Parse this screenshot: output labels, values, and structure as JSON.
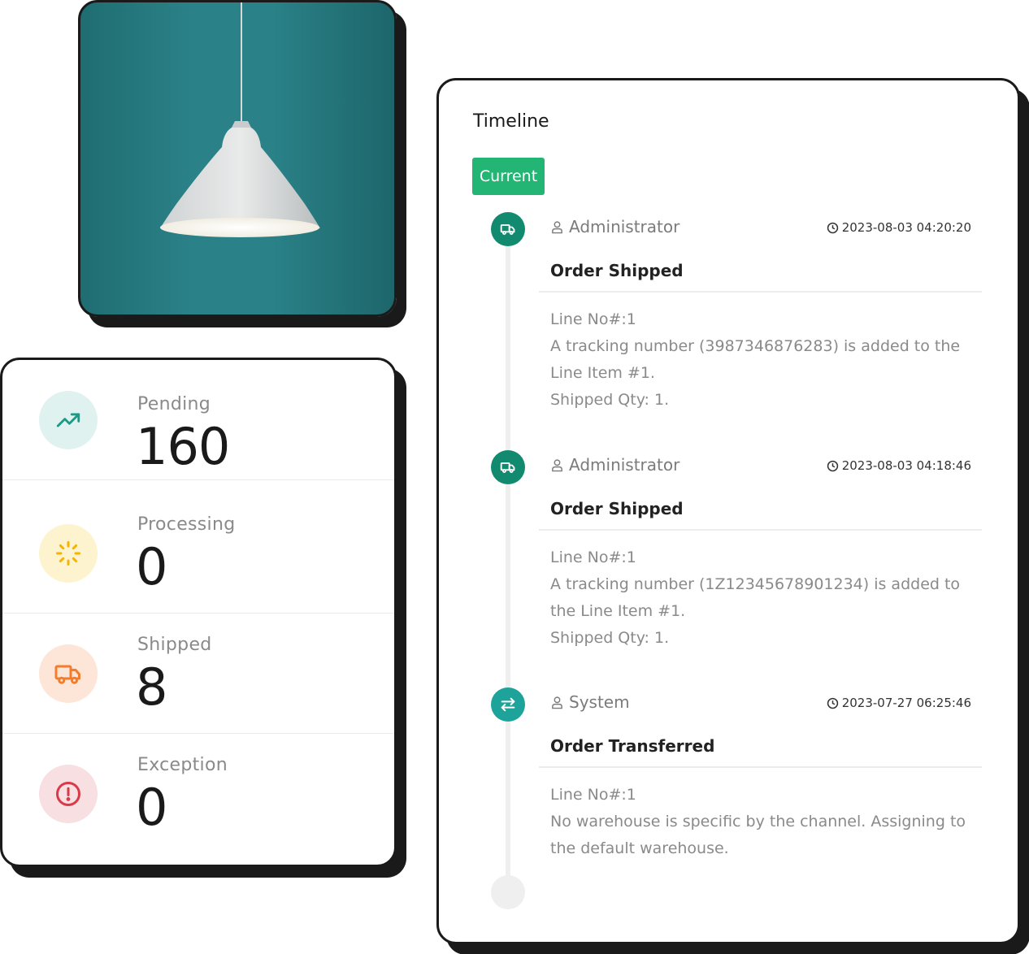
{
  "stats": [
    {
      "label": "Pending",
      "value": "160",
      "icon": "trending-up-icon",
      "icon_color": "#1a9b87",
      "bg": "#e0f2ef"
    },
    {
      "label": "Processing",
      "value": "0",
      "icon": "loader-icon",
      "icon_color": "#f4b400",
      "bg": "#fdf3cf"
    },
    {
      "label": "Shipped",
      "value": "8",
      "icon": "truck-icon",
      "icon_color": "#f57c2a",
      "bg": "#fde6d8"
    },
    {
      "label": "Exception",
      "value": "0",
      "icon": "alert-circle-icon",
      "icon_color": "#d93a4a",
      "bg": "#f8dfe2"
    }
  ],
  "timeline": {
    "title": "Timeline",
    "current_label": "Current",
    "entries": [
      {
        "user": "Administrator",
        "time": "2023-08-03 04:20:20",
        "event": "Order Shipped",
        "icon": "truck-icon",
        "lines": [
          "Line No#:1",
          "A tracking number (3987346876283) is added to the",
          "Line Item #1.",
          "Shipped Qty: 1."
        ]
      },
      {
        "user": "Administrator",
        "time": "2023-08-03 04:18:46",
        "event": "Order Shipped",
        "icon": "truck-icon",
        "lines": [
          "Line No#:1",
          "A tracking number (1Z12345678901234) is added to",
          "the Line Item #1.",
          "Shipped Qty: 1."
        ]
      },
      {
        "user": "System",
        "time": "2023-07-27 06:25:46",
        "event": "Order Transferred",
        "icon": "transfer-arrows-icon",
        "lines": [
          "Line No#:1",
          "No warehouse is specific by the channel. Assigning to",
          "the default warehouse."
        ]
      }
    ]
  },
  "colors": {
    "accent_green": "#22b573",
    "timeline_dot": "#128a6f",
    "timeline_dot_alt": "#1ea39a",
    "photo_bg": "#2a8187"
  }
}
